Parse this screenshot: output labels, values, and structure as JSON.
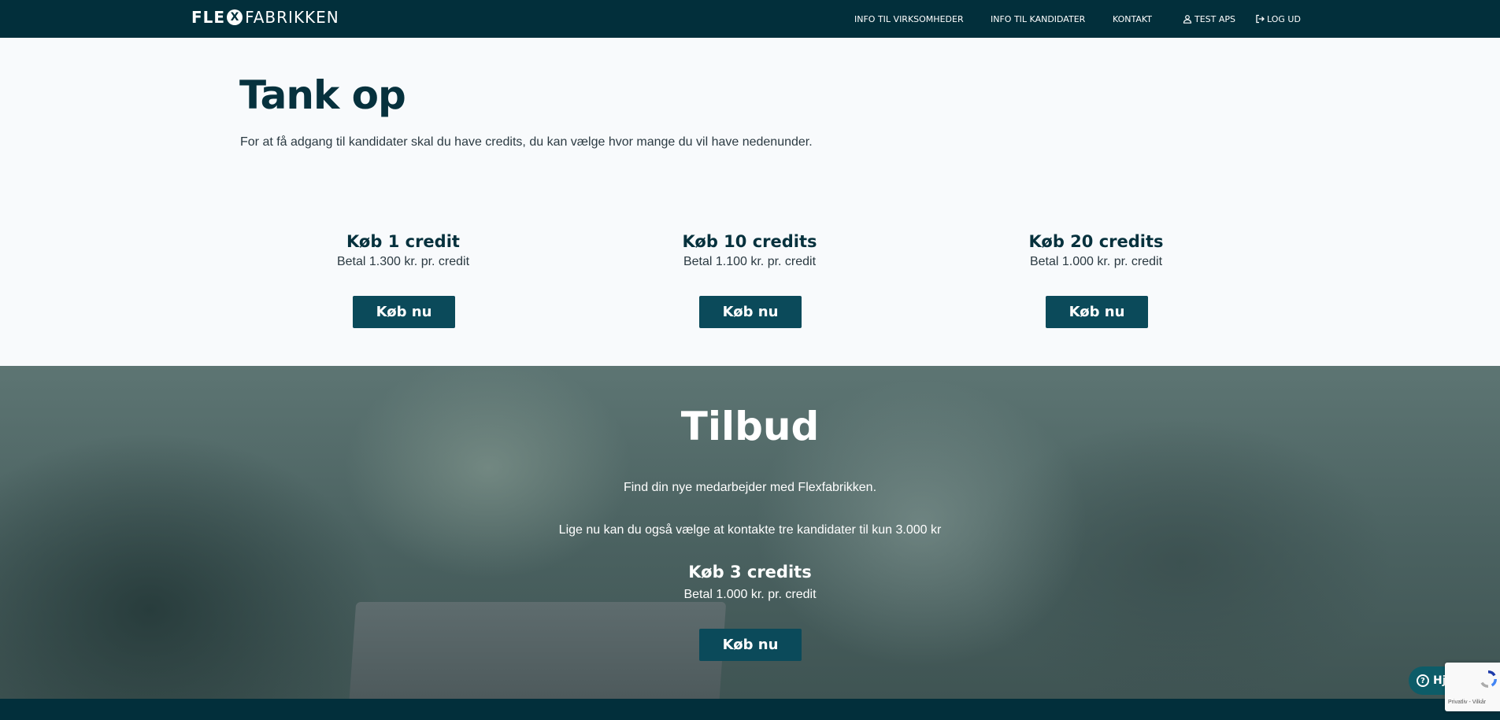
{
  "navbar": {
    "logo": {
      "part1": "FLE",
      "x_mark": "X",
      "part2": "FABRIKKEN"
    },
    "links": [
      {
        "label": "INFO TIL VIRKSOMHEDER"
      },
      {
        "label": "INFO TIL KANDIDATER"
      },
      {
        "label": "KONTAKT"
      },
      {
        "label": "TEST APS",
        "icon": "user-icon"
      },
      {
        "label": "LOG UD",
        "icon": "logout-icon"
      }
    ]
  },
  "hero": {
    "title": "Tank op",
    "text": "For at få adgang til kandidater skal du have credits, du kan vælge hvor mange du vil have nedenunder."
  },
  "packages": [
    {
      "title": "Køb 1 credit",
      "price": "Betal 1.300 kr. pr. credit",
      "button": "Køb nu"
    },
    {
      "title": "Køb 10 credits",
      "price": "Betal 1.100 kr. pr. credit",
      "button": "Køb nu"
    },
    {
      "title": "Køb 20 credits",
      "price": "Betal 1.000 kr. pr. credit",
      "button": "Køb nu"
    }
  ],
  "offer": {
    "title": "Tilbud",
    "line1": "Find din nye medarbejder med Flexfabrikken.",
    "line2": "Lige nu kan du også vælge at kontakte tre kandidater til kun 3.000 kr",
    "package_title": "Køb 3 credits",
    "package_price": "Betal 1.000 kr. pr. credit",
    "button": "Køb nu"
  },
  "help_widget": {
    "label": "Hjælp",
    "icon": "question-circle-icon"
  },
  "recaptcha": {
    "text": "Privatliv - Vilkår",
    "icon": "recaptcha-icon"
  },
  "colors": {
    "navbar": "#022f3b",
    "primary_button": "#0b4a5a",
    "heading": "#06313d"
  }
}
